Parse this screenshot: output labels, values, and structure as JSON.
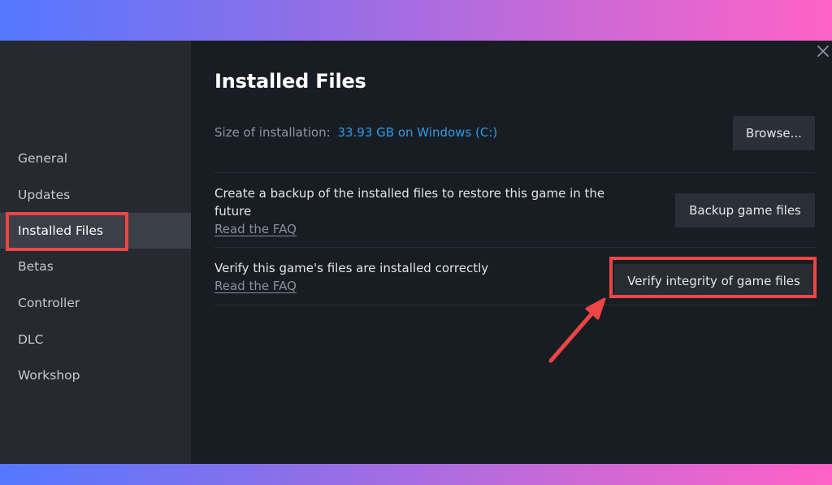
{
  "sidebar": {
    "items": [
      {
        "label": "General",
        "active": false
      },
      {
        "label": "Updates",
        "active": false
      },
      {
        "label": "Installed Files",
        "active": true
      },
      {
        "label": "Betas",
        "active": false
      },
      {
        "label": "Controller",
        "active": false
      },
      {
        "label": "DLC",
        "active": false
      },
      {
        "label": "Workshop",
        "active": false
      }
    ]
  },
  "main": {
    "title": "Installed Files",
    "size_label": "Size of installation:",
    "size_value": "33.93 GB on Windows (C:)",
    "browse_button": "Browse...",
    "backup": {
      "description": "Create a backup of the installed files to restore this game in the future",
      "link": "Read the FAQ",
      "button": "Backup game files"
    },
    "verify": {
      "description": "Verify this game's files are installed correctly",
      "link": "Read the FAQ",
      "button": "Verify integrity of game files"
    }
  },
  "window": {
    "close_icon": "close-icon"
  },
  "annotations": {
    "highlight_color": "#ef4545",
    "arrow_icon": "arrow-pointer-icon"
  },
  "colors": {
    "accent_link": "#2e9ae8",
    "gradient_start": "#5478ff",
    "gradient_end": "#ff62c6"
  }
}
